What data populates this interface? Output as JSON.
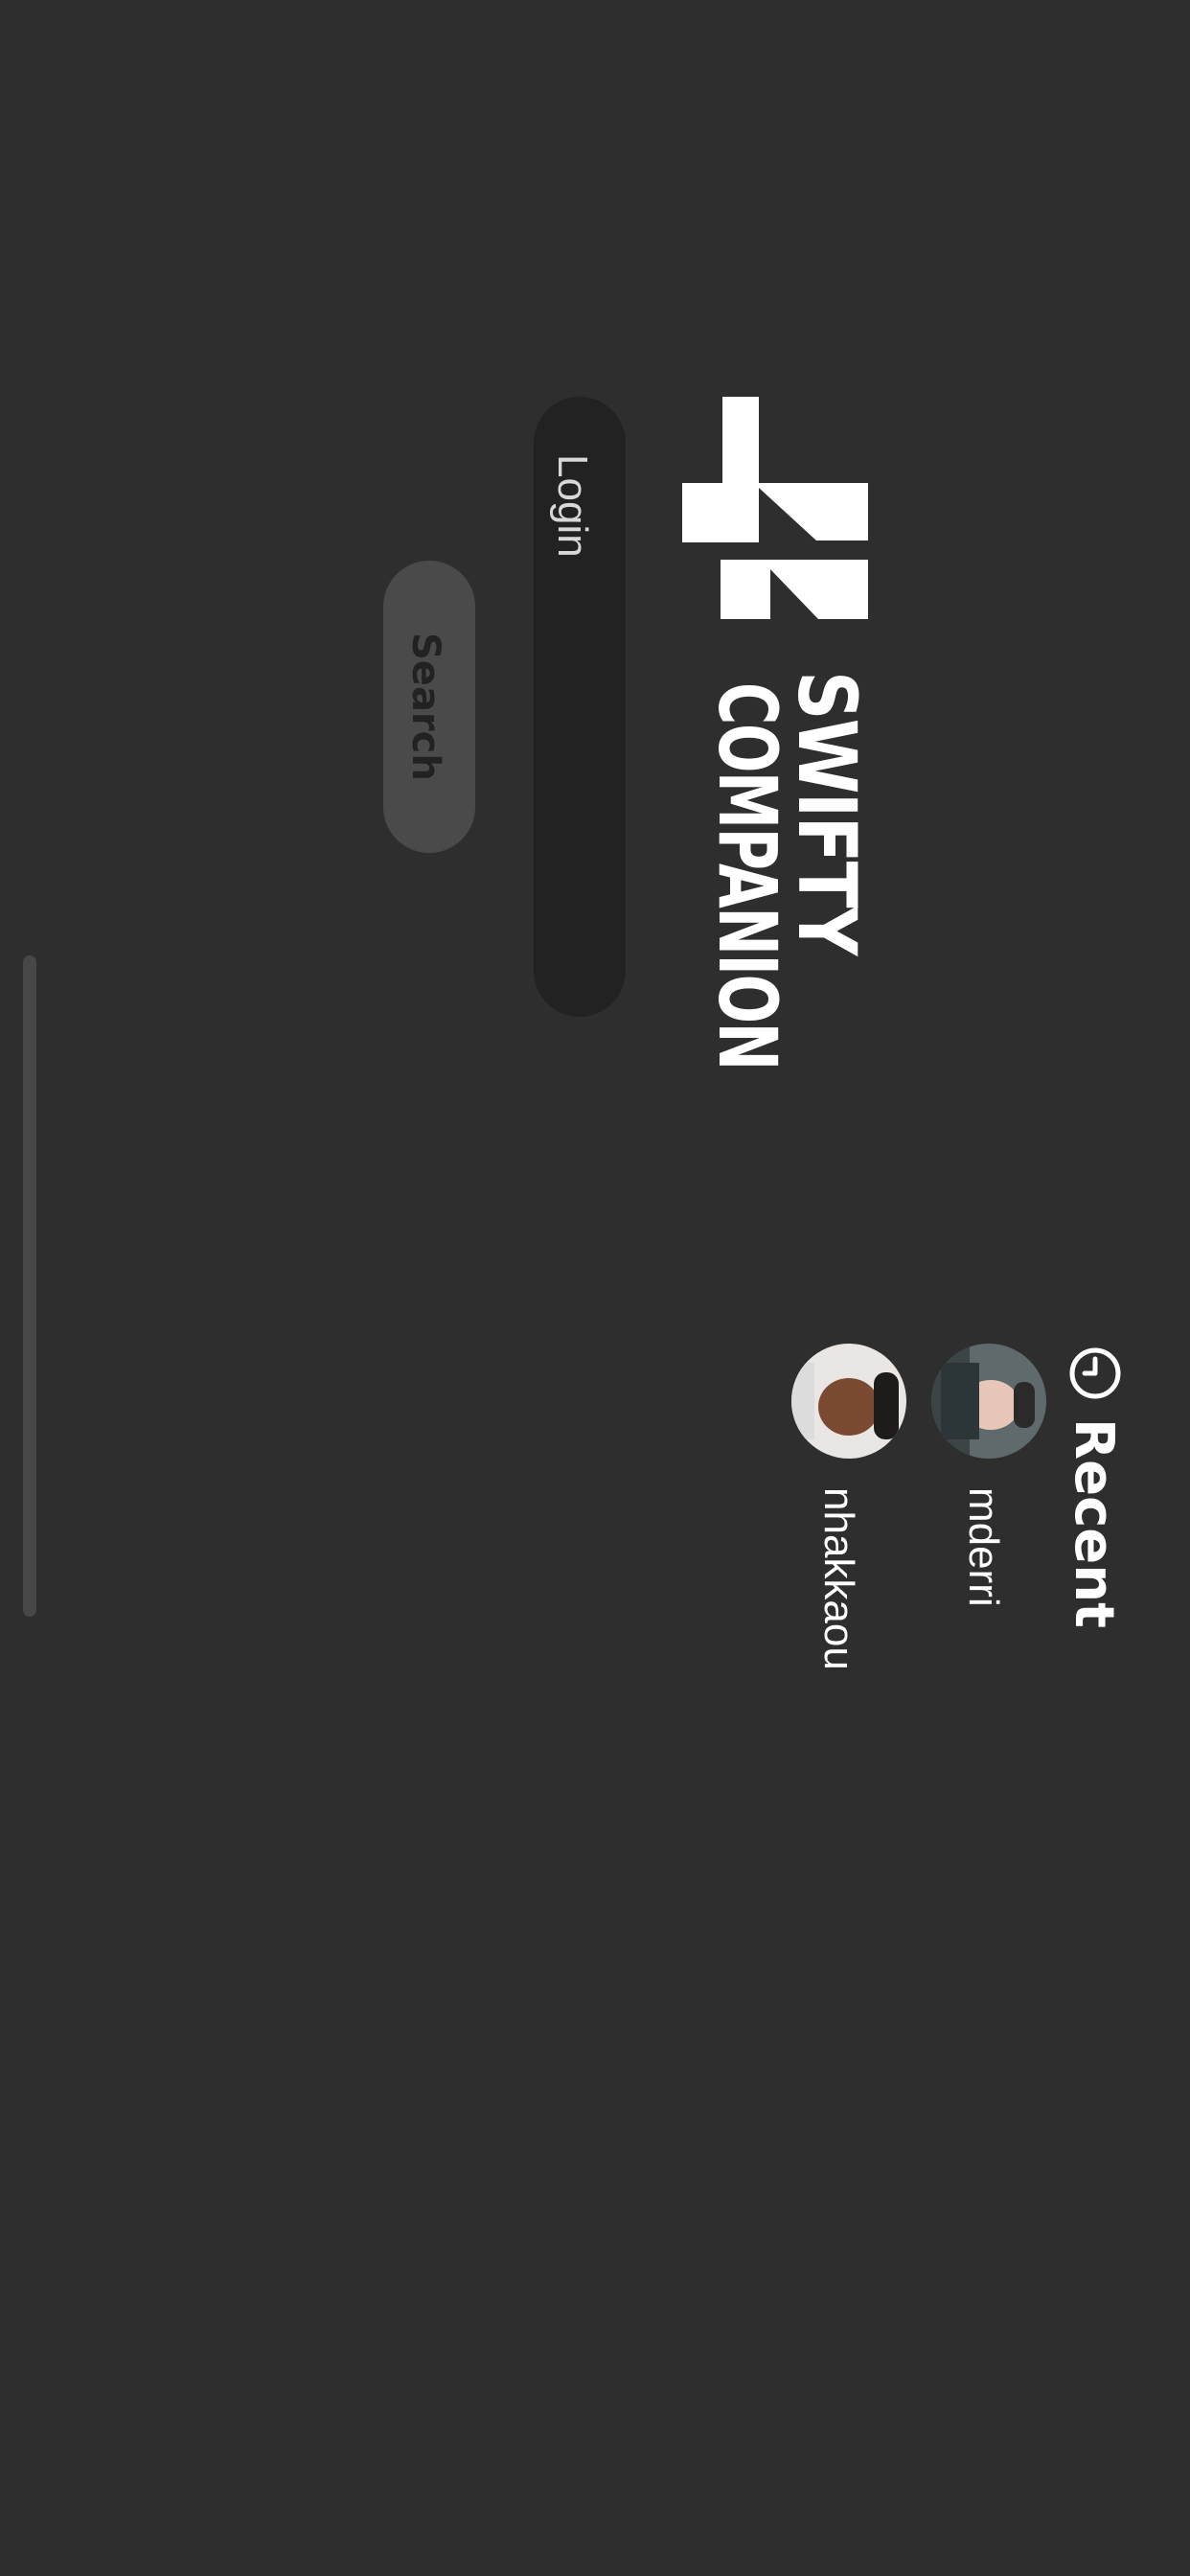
{
  "logo": {
    "number": "42",
    "line1": "SWIFTY",
    "line2": "COMPANION"
  },
  "login": {
    "placeholder": "Login"
  },
  "search": {
    "label": "Search"
  },
  "recent": {
    "title": "Recent",
    "icon": "clock-icon",
    "items": [
      {
        "login": "mderri"
      },
      {
        "login": "nhakkaou"
      }
    ]
  },
  "colors": {
    "background": "#2e2e2e",
    "field": "#222222",
    "button": "#4a4a4a",
    "text": "#ffffff"
  }
}
